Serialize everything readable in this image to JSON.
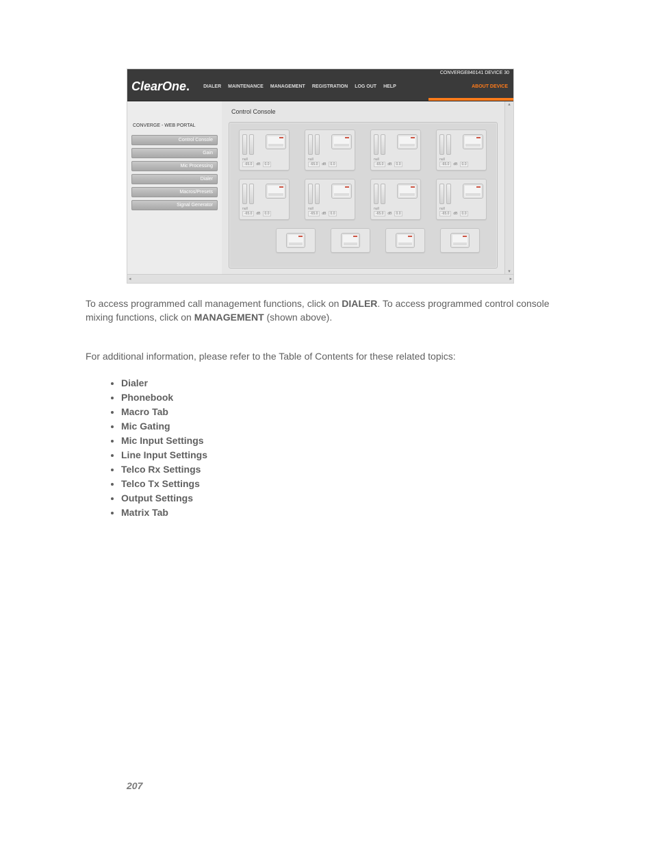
{
  "screenshot": {
    "device_label": "CONVERGE840141 DEVICE 30",
    "logo": "ClearOne.",
    "nav": [
      "DIALER",
      "MAINTENANCE",
      "MANAGEMENT",
      "REGISTRATION",
      "LOG OUT",
      "HELP"
    ],
    "about": "ABOUT DEVICE",
    "sidebar_title": "CONVERGE - WEB PORTAL",
    "sidebar_items": [
      "Control Console",
      "Gain",
      "Mic Processing",
      "Dialer",
      "Macros/Presets",
      "Signal Generator"
    ],
    "main_title": "Control Console",
    "card_readout_val": "-65.0",
    "card_readout_unit": "dB",
    "card_readout_extra": "0.0",
    "card_label": "null"
  },
  "paragraph1_pre": "To access programmed call management functions, click on ",
  "paragraph1_b1": "DIALER",
  "paragraph1_mid": ". To access programmed control console mixing functions, click on ",
  "paragraph1_b2": "MANAGEMENT",
  "paragraph1_post": " (shown above).",
  "paragraph2": "For additional information, please refer to the Table of Contents for these related topics:",
  "topics": [
    "Dialer",
    "Phonebook",
    "Macro Tab",
    "Mic Gating",
    "Mic Input Settings",
    "Line Input Settings",
    "Telco Rx Settings",
    "Telco Tx Settings",
    "Output Settings",
    "Matrix Tab"
  ],
  "page_number": "207"
}
